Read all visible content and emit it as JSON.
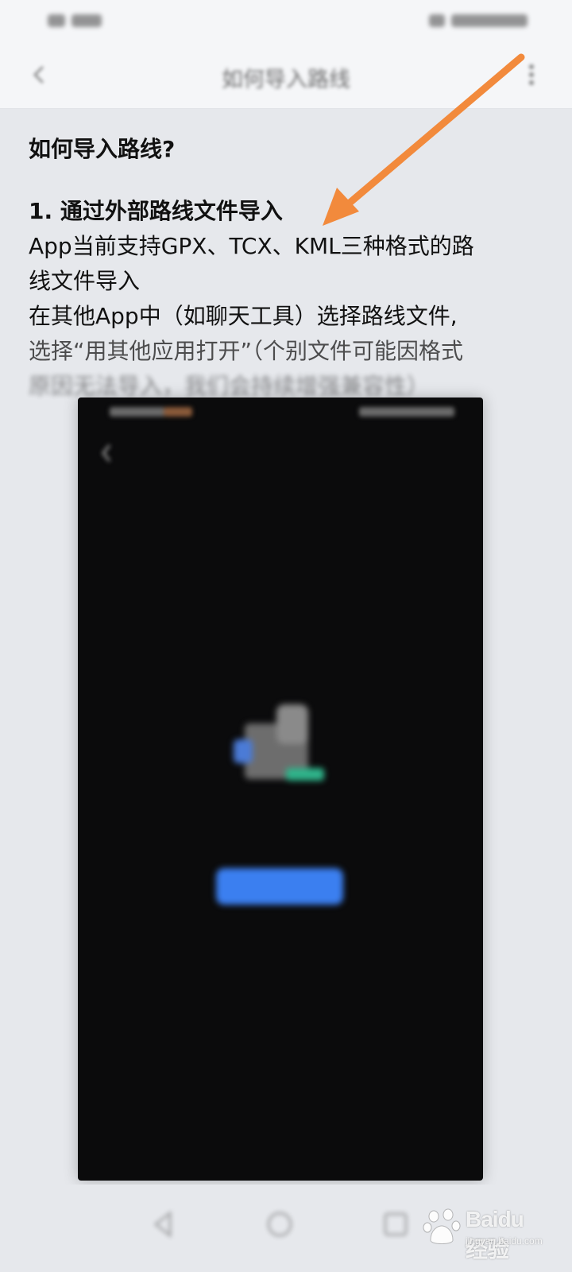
{
  "header": {
    "title": "如何导入路线"
  },
  "article": {
    "heading": "如何导入路线?",
    "section_title": "1. 通过外部路线文件导入",
    "paragraph_lines": [
      "App当前支持GPX、TCX、KML三种格式的路",
      "线文件导入",
      "在其他App中（如聊天工具）选择路线文件,",
      "选择“用其他应用打开”（个别文件可能因格式",
      "原因无法导入，我们会持续增强兼容性）"
    ]
  },
  "embedded_screenshot": {
    "title": "",
    "message": "",
    "submessage": "",
    "button_label": ""
  },
  "watermark": {
    "brand": "Baidu经验",
    "domain": "jingyan.baidu.com"
  },
  "colors": {
    "annotation_arrow": "#f28a3c",
    "embed_button": "#3b7ff0",
    "page_background": "#e6e8ec"
  },
  "icons": {
    "back": "chevron-left-icon",
    "more": "more-vertical-icon",
    "nav_back": "nav-back-icon",
    "nav_home": "nav-home-icon",
    "nav_recent": "nav-recent-icon"
  }
}
